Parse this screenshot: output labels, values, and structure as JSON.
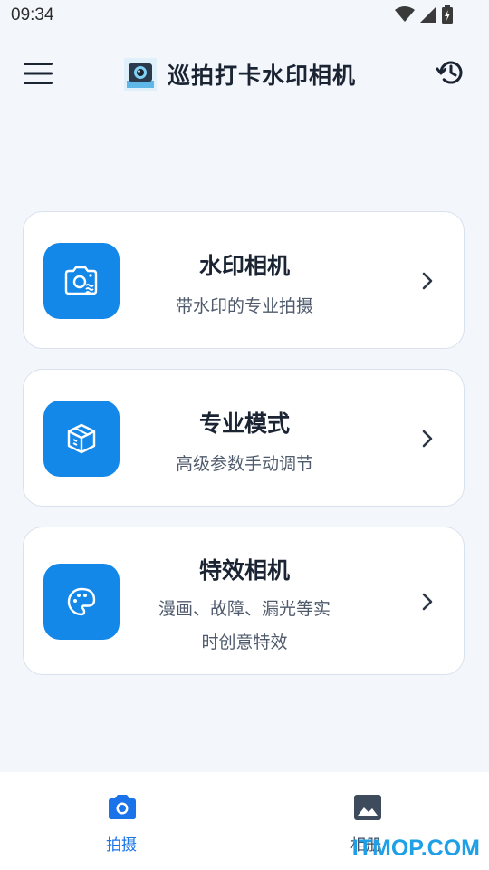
{
  "status_bar": {
    "time": "09:34"
  },
  "app_bar": {
    "title": "巡拍打卡水印相机"
  },
  "cards": [
    {
      "title": "水印相机",
      "subtitle": "带水印的专业拍摄",
      "icon": "watermark-camera-icon"
    },
    {
      "title": "专业模式",
      "subtitle": "高级参数手动调节",
      "icon": "cube-icon"
    },
    {
      "title": "特效相机",
      "subtitle_line1": "漫画、故障、漏光等实",
      "subtitle_line2": "时创意特效",
      "icon": "palette-icon"
    }
  ],
  "bottom_nav": {
    "items": [
      {
        "label": "拍摄",
        "icon": "camera-icon",
        "active": true
      },
      {
        "label": "相册",
        "icon": "image-icon",
        "active": false
      }
    ]
  },
  "watermark": "ITMOP.COM",
  "colors": {
    "accent": "#1488e8",
    "background": "#f3f6fb",
    "nav_active": "#1a73e8",
    "nav_inactive": "#3d4b5c"
  }
}
